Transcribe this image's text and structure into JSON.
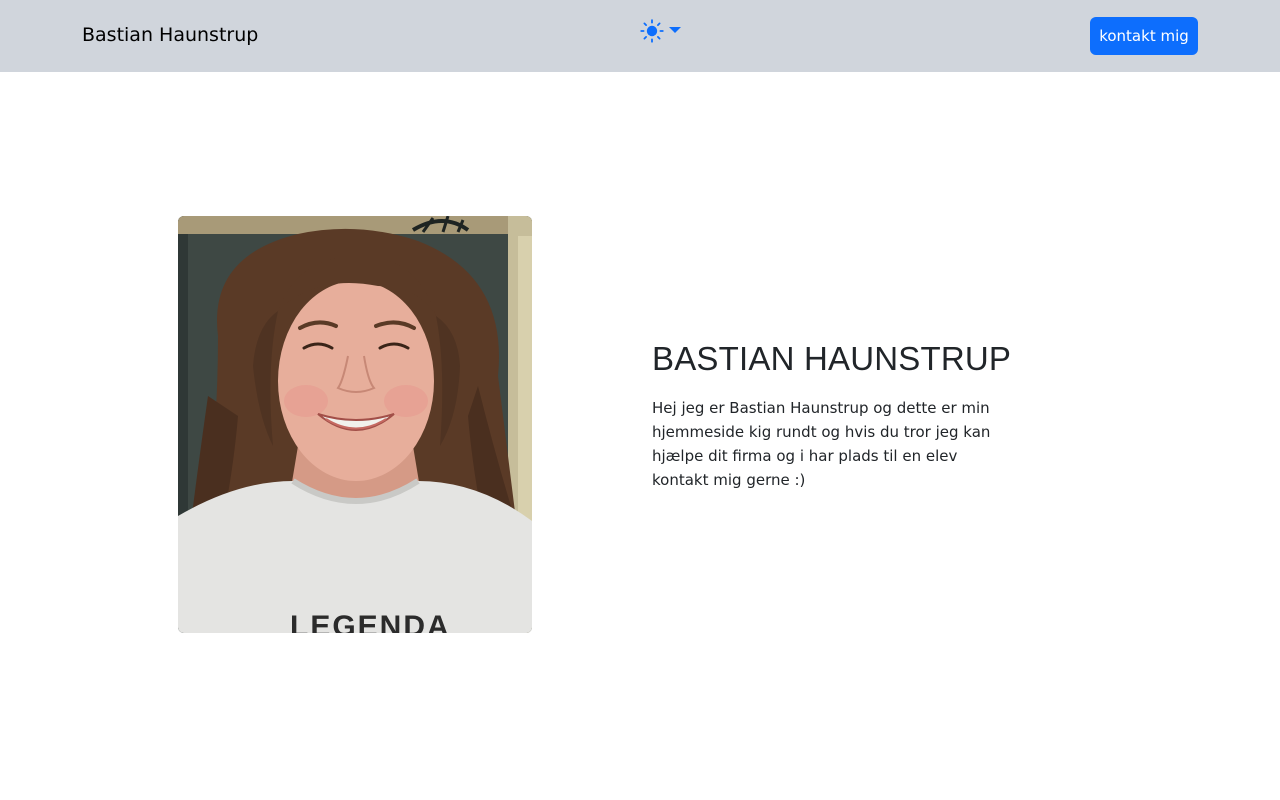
{
  "navbar": {
    "brand": "Bastian Haunstrup",
    "theme_toggle_icon": "sun-icon",
    "contact_button": "kontakt mig",
    "accent_color": "#0d6efd",
    "background_color": "#d0d5dc"
  },
  "hero": {
    "photo_icon": "profile-photo",
    "shirt_text": "LEGENDA",
    "title": "BASTIAN HAUNSTRUP",
    "text": "Hej jeg er Bastian Haunstrup og dette er min hjemmeside kig rundt og hvis du tror jeg kan hjælpe dit firma og i har plads til en elev kontakt mig gerne :)"
  }
}
